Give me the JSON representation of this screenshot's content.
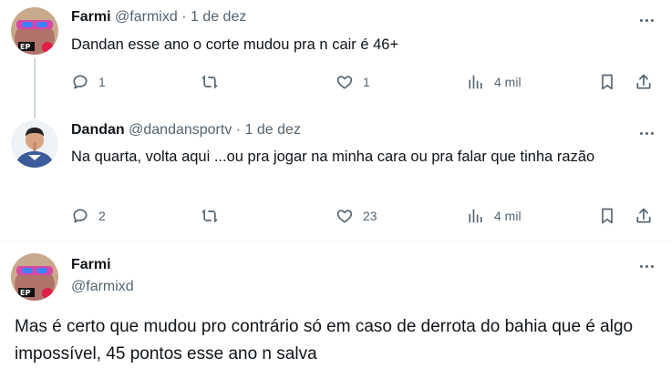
{
  "tweets": [
    {
      "name": "Farmi",
      "handle": "@farmixd",
      "sep": "·",
      "date": "1 de dez",
      "text": "Dandan esse ano o corte mudou pra n cair é 46+",
      "replies": "1",
      "retweets": "",
      "likes": "1",
      "views": "4 mil"
    },
    {
      "name": "Dandan",
      "handle": "@dandansportv",
      "sep": "·",
      "date": "1 de dez",
      "text": "Na quarta, volta aqui ...ou pra jogar na minha cara ou pra falar que tinha razão",
      "replies": "2",
      "retweets": "",
      "likes": "23",
      "views": "4 mil"
    },
    {
      "name": "Farmi",
      "handle": "@farmixd",
      "text": "Mas é certo que mudou pro contrário só em caso de derrota do bahia que é algo impossível, 45 pontos esse ano n salva"
    }
  ],
  "icons": {
    "reply": "speech-bubble",
    "retweet": "repeat-arrows",
    "like": "heart",
    "views": "bar-chart",
    "bookmark": "bookmark",
    "share": "upload-arrow",
    "more": "three-dots"
  },
  "colors": {
    "text": "#0f1419",
    "secondary": "#536471",
    "thread_line": "#cfd9de"
  }
}
